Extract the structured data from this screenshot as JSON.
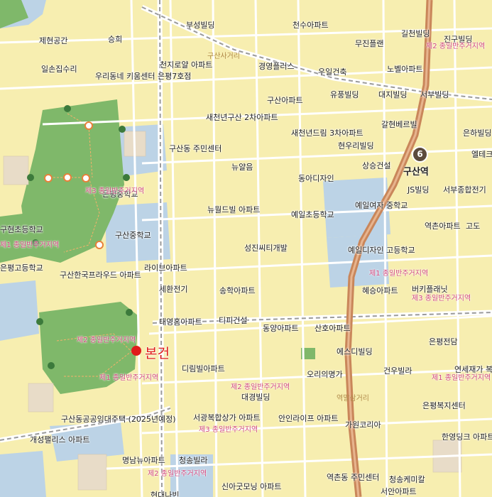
{
  "map": {
    "marker_label": "본건",
    "station": {
      "line_number": "6",
      "name": "구산역"
    },
    "colors": {
      "background": "#f7eeb0",
      "park": "#7fb86a",
      "school": "#bcd3e6",
      "marker": "#e01c1c",
      "rail": "#c9865a",
      "zone_text": "#d2477e"
    },
    "labels": [
      "부성빌딩",
      "천수아파트",
      "길천빌딩",
      "진구빌딩",
      "승희",
      "무진플랜",
      "제현공간",
      "천지로얄 아파트",
      "경영플러스",
      "우일건축",
      "노벨아파트",
      "일손집수리",
      "우리동네 키움센터 은평7호점",
      "유풍빌딩",
      "대지빌딩",
      "서부빌딩",
      "구산아파트",
      "새천년구산 2차아파트",
      "새천년드림 3차아파트",
      "현우리빌딩",
      "갈현베르빌",
      "은하빌딩",
      "엘테크",
      "구산동 주민센터",
      "뉴얄음",
      "상승건설",
      "동아디자인",
      "은평중학교",
      "JS빌딩",
      "서부종합전기",
      "예일여자 중학교",
      "뉴월드빌 아파트",
      "예일초등학교",
      "역촌아파트",
      "고도",
      "구현초등학교",
      "구산중학교",
      "성진씨티개발",
      "예일디자인 고등학교",
      "은평고등학교",
      "라이브아파트",
      "구산한국프라우드 아파트",
      "혜승아파트",
      "버키플래닛",
      "세환전기",
      "송학아파트",
      "태영홈아파트",
      "티피건설",
      "동양아파트",
      "산호아파트",
      "은평전담",
      "에스디빌딩",
      "디림빌아파트",
      "오리의명가",
      "건우빌라",
      "연세재가 복지센터",
      "대경빌딩",
      "은평복지센터",
      "구산동공공임대주택 (2025년예정)",
      "서광복합상가 아파트",
      "안인라이프 아파트",
      "가원코리아",
      "개성팰리스 아파트",
      "명남뉴아파트",
      "청송빌라",
      "한영딩크 아파트",
      "신아굿모닝 아파트",
      "역촌동 주민센터",
      "청송케미칼",
      "서안아파트",
      "현대나빈"
    ],
    "zones": [
      "제1 종일반주거지역",
      "제2 종일반주거지역",
      "제3 종일반주거지역"
    ],
    "roads": [
      "구산사거리",
      "역말삼거리"
    ]
  }
}
